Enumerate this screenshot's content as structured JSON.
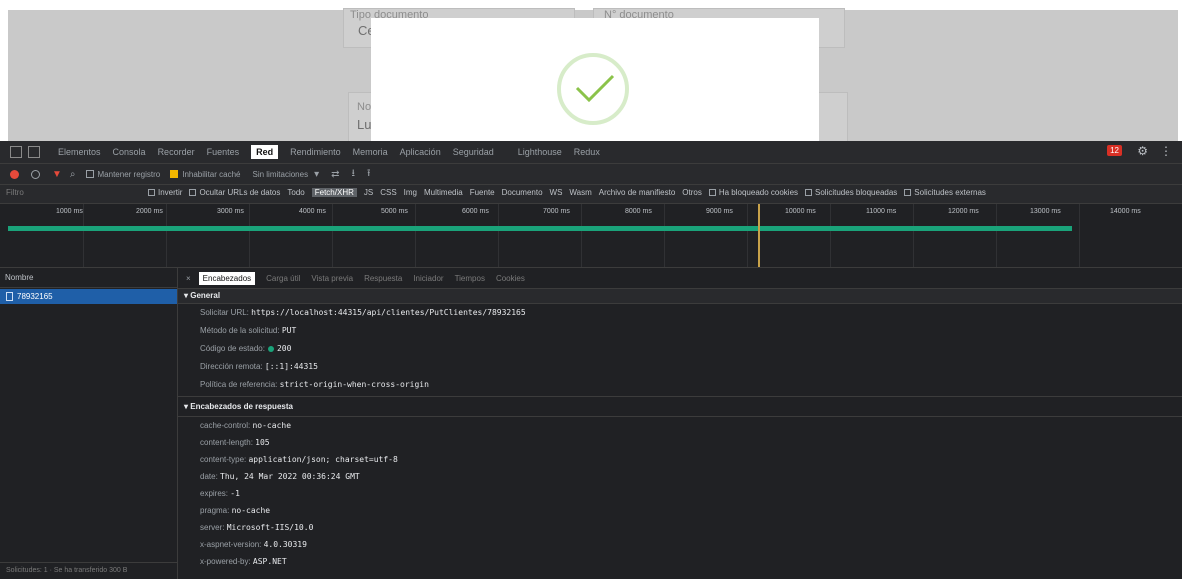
{
  "page": {
    "fields": [
      {
        "label": "Tipo documento",
        "value": "Ce"
      },
      {
        "label": "N° documento",
        "value": ""
      },
      {
        "label": "No",
        "value": "Lu"
      }
    ]
  },
  "devtools": {
    "tabs": [
      "Elementos",
      "Consola",
      "Recorder",
      "Fuentes",
      "Red",
      "Rendimiento",
      "Memoria",
      "Aplicación",
      "Seguridad",
      "Lighthouse",
      "Redux"
    ],
    "active_tab": "Red",
    "error_badge": "12",
    "toolbar": {
      "preserve_log": "Mantener registro",
      "disable_cache": "Inhabilitar caché",
      "throttling": "Sin limitaciones"
    },
    "filter": {
      "placeholder": "Filtro",
      "invert": "Invertir",
      "hide_data_urls": "Ocultar URLs de datos",
      "types": [
        "Todo",
        "Fetch/XHR",
        "JS",
        "CSS",
        "Img",
        "Multimedia",
        "Fuente",
        "Documento",
        "WS",
        "Wasm",
        "Archivo de manifiesto",
        "Otros"
      ],
      "active_type": "Fetch/XHR",
      "blocked_cookies": "Ha bloqueado cookies",
      "blocked_requests": "Solicitudes bloqueadas",
      "third_party": "Solicitudes externas"
    },
    "timeline": {
      "ticks": [
        "1000 ms",
        "2000 ms",
        "3000 ms",
        "4000 ms",
        "5000 ms",
        "6000 ms",
        "7000 ms",
        "8000 ms",
        "9000 ms",
        "10000 ms",
        "11000 ms",
        "12000 ms",
        "13000 ms",
        "14000 ms"
      ]
    },
    "requests": {
      "header": "Nombre",
      "items": [
        "78932165"
      ],
      "footer": "Solicitudes: 1 · Se ha transferido 300 B"
    },
    "details": {
      "tabs": [
        "Encabezados",
        "Carga útil",
        "Vista previa",
        "Respuesta",
        "Iniciador",
        "Tiempos",
        "Cookies"
      ],
      "active_tab": "Encabezados",
      "general_title": "General",
      "general": [
        {
          "key": "Solicitar URL:",
          "value": "https://localhost:44315/api/clientes/PutClientes/78932165"
        },
        {
          "key": "Método de la solicitud:",
          "value": "PUT"
        },
        {
          "key": "Código de estado:",
          "value": "200"
        },
        {
          "key": "Dirección remota:",
          "value": "[::1]:44315"
        },
        {
          "key": "Política de referencia:",
          "value": "strict-origin-when-cross-origin"
        }
      ],
      "response_title": "Encabezados de respuesta",
      "response": [
        {
          "key": "cache-control:",
          "value": "no-cache"
        },
        {
          "key": "content-length:",
          "value": "105"
        },
        {
          "key": "content-type:",
          "value": "application/json; charset=utf-8"
        },
        {
          "key": "date:",
          "value": "Thu, 24 Mar 2022 00:36:24 GMT"
        },
        {
          "key": "expires:",
          "value": "-1"
        },
        {
          "key": "pragma:",
          "value": "no-cache"
        },
        {
          "key": "server:",
          "value": "Microsoft-IIS/10.0"
        },
        {
          "key": "x-aspnet-version:",
          "value": "4.0.30319"
        },
        {
          "key": "x-powered-by:",
          "value": "ASP.NET"
        }
      ]
    }
  },
  "colors": {
    "accent": "#1aa37a",
    "error": "#d93025",
    "selected": "#1f5fa8"
  }
}
